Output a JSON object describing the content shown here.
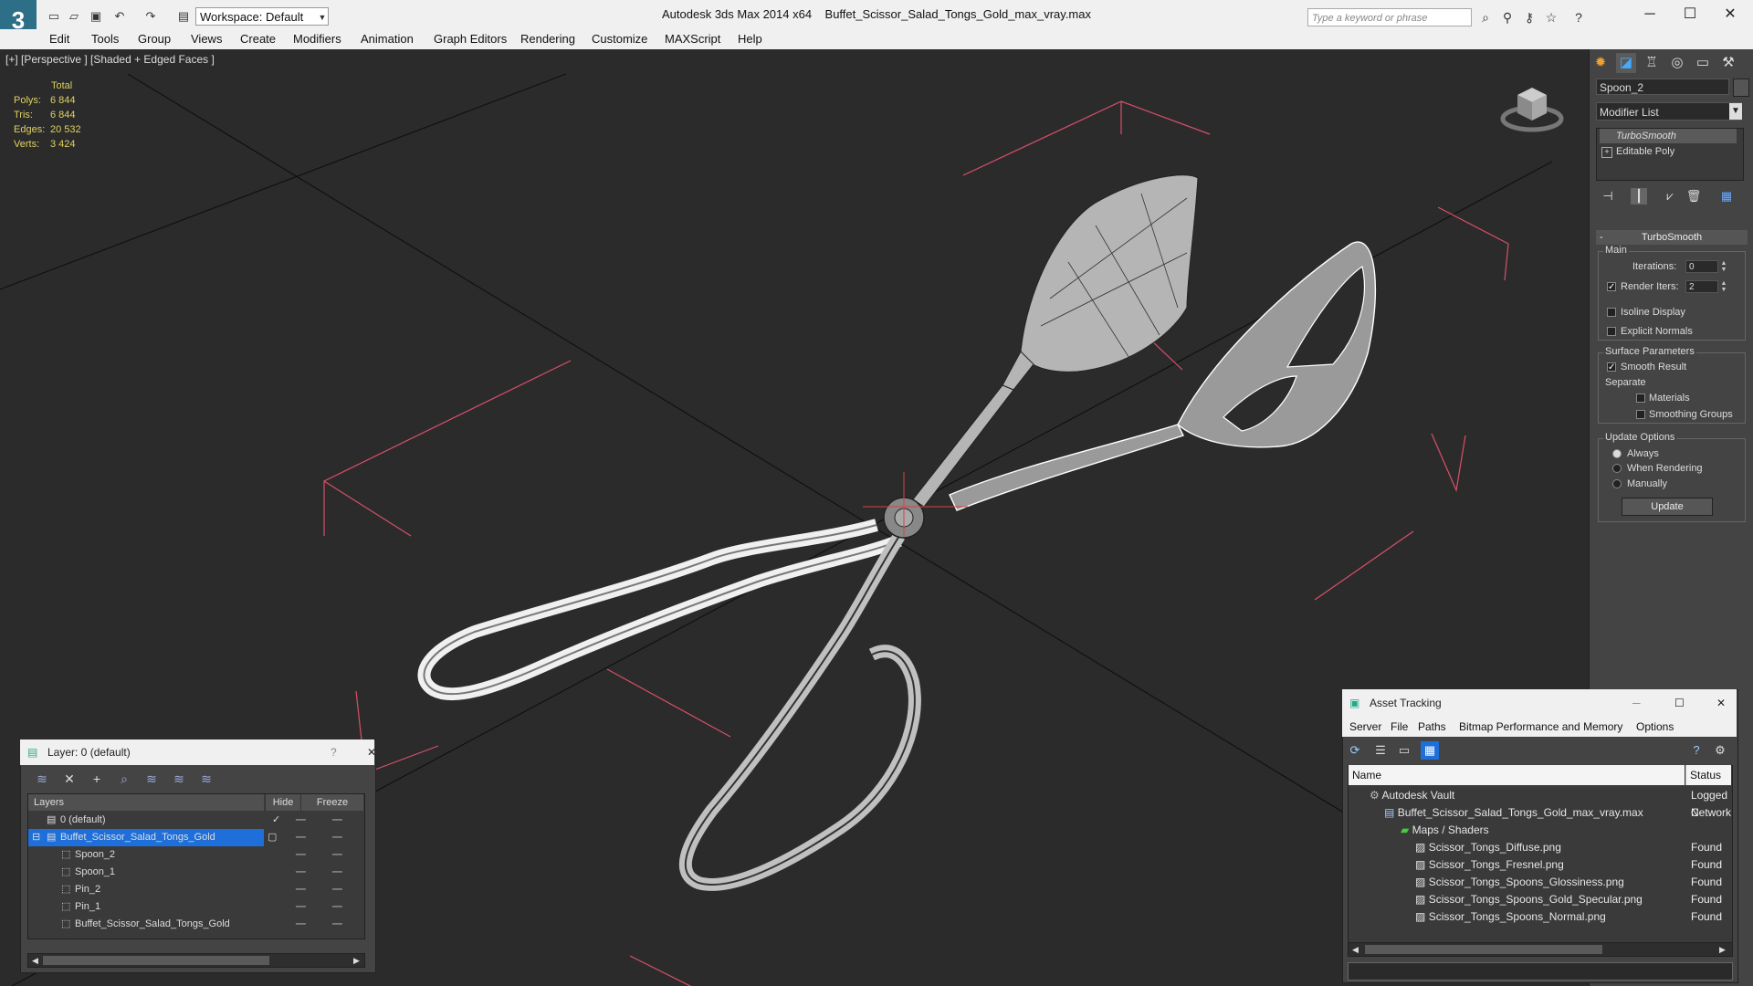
{
  "title": {
    "app": "Autodesk 3ds Max  2014 x64",
    "file": "Buffet_Scissor_Salad_Tongs_Gold_max_vray.max",
    "workspace": "Workspace: Default",
    "search_placeholder": "Type a keyword or phrase"
  },
  "menu": [
    "Edit",
    "Tools",
    "Group",
    "Views",
    "Create",
    "Modifiers",
    "Animation",
    "Graph Editors",
    "Rendering",
    "Customize",
    "MAXScript",
    "Help"
  ],
  "viewport": {
    "label": "[+] [Perspective ] [Shaded + Edged Faces ]",
    "stats_header": "Total",
    "stats": [
      {
        "name": "Polys:",
        "value": "6 844"
      },
      {
        "name": "Tris:",
        "value": "6 844"
      },
      {
        "name": "Edges:",
        "value": "20 532"
      },
      {
        "name": "Verts:",
        "value": "3 424"
      }
    ]
  },
  "command_panel": {
    "object_name": "Spoon_2",
    "modifier_list": "Modifier List",
    "stack": [
      "TurboSmooth",
      "Editable Poly"
    ],
    "rollout": "TurboSmooth",
    "main_group": "Main",
    "iterations_label": "Iterations:",
    "iterations_value": "0",
    "render_iters_label": "Render Iters:",
    "render_iters_value": "2",
    "isoline": "Isoline Display",
    "explicit_normals": "Explicit Normals",
    "surface_group": "Surface Parameters",
    "smooth_result": "Smooth Result",
    "separate": "Separate",
    "materials": "Materials",
    "smoothing_groups": "Smoothing Groups",
    "update_group": "Update Options",
    "always": "Always",
    "when_rendering": "When Rendering",
    "manually": "Manually",
    "update_button": "Update"
  },
  "layer_dialog": {
    "title": "Layer: 0 (default)",
    "help": "?",
    "columns": {
      "layers": "Layers",
      "hide": "Hide",
      "freeze": "Freeze"
    },
    "rows": [
      {
        "name": "0 (default)"
      },
      {
        "name": "Buffet_Scissor_Salad_Tongs_Gold"
      },
      {
        "name": "Spoon_2"
      },
      {
        "name": "Spoon_1"
      },
      {
        "name": "Pin_2"
      },
      {
        "name": "Pin_1"
      },
      {
        "name": "Buffet_Scissor_Salad_Tongs_Gold"
      }
    ]
  },
  "asset_tracking": {
    "title": "Asset Tracking",
    "menu": [
      "Server",
      "File",
      "Paths",
      "Bitmap Performance and Memory",
      "Options"
    ],
    "columns": {
      "name": "Name",
      "status": "Status"
    },
    "rows": [
      {
        "name": "Autodesk Vault",
        "status": "Logged C"
      },
      {
        "name": "Buffet_Scissor_Salad_Tongs_Gold_max_vray.max",
        "status": "Network"
      },
      {
        "name": "Maps / Shaders",
        "status": ""
      },
      {
        "name": "Scissor_Tongs_Diffuse.png",
        "status": "Found"
      },
      {
        "name": "Scissor_Tongs_Fresnel.png",
        "status": "Found"
      },
      {
        "name": "Scissor_Tongs_Spoons_Glossiness.png",
        "status": "Found"
      },
      {
        "name": "Scissor_Tongs_Spoons_Gold_Specular.png",
        "status": "Found"
      },
      {
        "name": "Scissor_Tongs_Spoons_Normal.png",
        "status": "Found"
      }
    ]
  },
  "colors": {
    "selection": "#1e6fd9",
    "stats": "#e0d060",
    "grid": "#e05070",
    "mesh": "#d8d8d8"
  }
}
